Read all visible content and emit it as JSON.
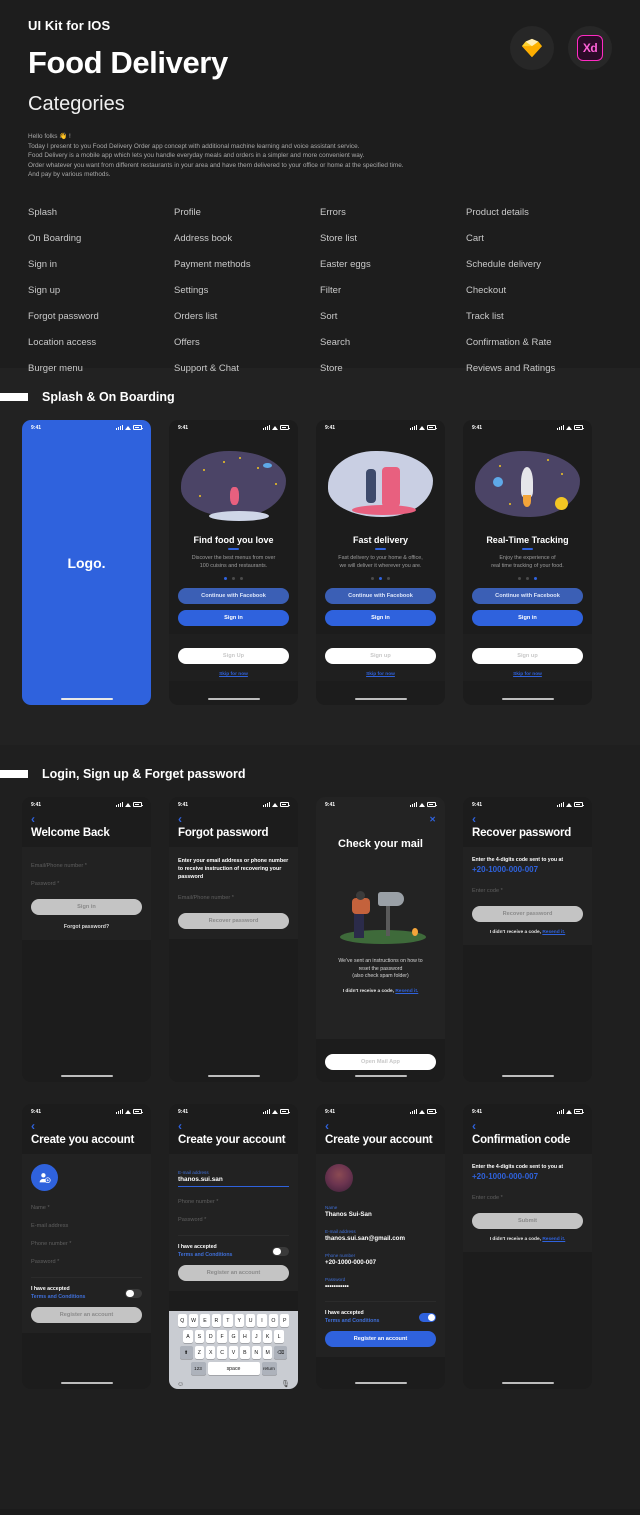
{
  "hero": {
    "kicker": "UI Kit for IOS",
    "title": "Food Delivery",
    "subtitle": "Categories",
    "desc_lines": [
      "Hello folks 👋 !",
      "Today I present to you Food Delivery Order app concept with additional machine learning and voice assistant service.",
      "Food Delivery is a mobile app which lets you handle everyday meals and orders in a simpler and more convenient way.",
      "Order whatever you want from different restaurants in your area and have them delivered to your office or home at the specified time.",
      "And pay by various methods."
    ],
    "badges": [
      {
        "name": "sketch-badge",
        "label": ""
      },
      {
        "name": "adobe-xd-badge",
        "label": "Xd"
      }
    ]
  },
  "categories": [
    "Splash",
    "Profile",
    "Errors",
    "Product details",
    "On Boarding",
    "Address book",
    "Store list",
    "Cart",
    "Sign in",
    "Payment methods",
    "Easter eggs",
    "Schedule delivery",
    "Sign up",
    "Settings",
    "Filter",
    "Checkout",
    "Forgot password",
    "Orders list",
    "Sort",
    "Track list",
    "Location access",
    "Offers",
    "Search",
    "Confirmation & Rate",
    "Burger menu",
    "Support & Chat",
    "Store",
    "Reviews and Ratings"
  ],
  "sections": {
    "onboarding_title": "Splash & On Boarding",
    "login_title": "Login, Sign up & Forget password"
  },
  "status": {
    "time": "9:41"
  },
  "splash": {
    "logo": "Logo."
  },
  "onboarding": [
    {
      "title": "Find food you love",
      "subtitle_line1": "Discover the best menus from over",
      "subtitle_line2": "100 cuisins and restaurants.",
      "active_dot": 0,
      "btn_facebook": "Continue with Facebook",
      "btn_signin": "Sign in",
      "btn_signup": "Sign Up",
      "skip": "Skip for now"
    },
    {
      "title": "Fast delivery",
      "subtitle_line1": "Fast delivery to your home & office,",
      "subtitle_line2": "we will deliver it wherever you are.",
      "active_dot": 1,
      "btn_facebook": "Continue with Facebook",
      "btn_signin": "Sign in",
      "btn_signup": "Sign up",
      "skip": "Skip for now"
    },
    {
      "title": "Real-Time Tracking",
      "subtitle_line1": "Enjoy the experience of",
      "subtitle_line2": "real time tracking of your food.",
      "active_dot": 2,
      "btn_facebook": "Continue with Facebook",
      "btn_signin": "Sign in",
      "btn_signup": "Sign up",
      "skip": "Skip for now"
    }
  ],
  "login": {
    "title": "Welcome Back",
    "field_email": "Email/Phone number *",
    "field_password": "Password *",
    "btn_signin": "Sign in",
    "forgot": "Forgot password?"
  },
  "forgot": {
    "title": "Forgot password",
    "instruction": "Enter your email address or phone number to receive instruction of recovering your password",
    "field_email": "Email/Phone number *",
    "btn_recover": "Recover password"
  },
  "check_mail": {
    "title": "Check your mail",
    "body_line1": "We've sent an instructions on how to",
    "body_line2": "reset the password",
    "body_line3": "(also check spam folder)",
    "resend_prefix": "I didn't receive a code,",
    "resend_link": "Resend it.",
    "btn_open": "Open Mail App"
  },
  "recover": {
    "title": "Recover password",
    "instruction": "Enter the 4-digits code sent to you at",
    "phone": "+20-1000-000-007",
    "field_code": "Enter code *",
    "btn_recover": "Recover password",
    "resend_prefix": "I didn't receive a code,",
    "resend_link": "Resend it."
  },
  "create_empty": {
    "title": "Create you account",
    "avatar_icon": "add-photo-icon",
    "field_name": "Name *",
    "field_email": "E-mail address",
    "field_phone": "Phone number *",
    "field_password": "Password *",
    "accept_line1": "I have accepted",
    "accept_line2": "Terms and Conditions",
    "toggle_on": false,
    "btn_register": "Register an account"
  },
  "create_typing": {
    "title": "Create your account",
    "label_email": "E-mail address",
    "value_email": "thanos.sui.san",
    "field_phone": "Phone number *",
    "field_password": "Password *",
    "accept_line1": "I have accepted",
    "accept_line2": "Terms and Conditions",
    "toggle_on": false,
    "btn_register": "Register an account",
    "keyboard": {
      "row1": [
        "Q",
        "W",
        "E",
        "R",
        "T",
        "Y",
        "U",
        "I",
        "O",
        "P"
      ],
      "row2": [
        "A",
        "S",
        "D",
        "F",
        "G",
        "H",
        "J",
        "K",
        "L"
      ],
      "row3": [
        "Z",
        "X",
        "C",
        "V",
        "B",
        "N",
        "M"
      ],
      "shift": "⬆",
      "backspace": "⌫",
      "numbers": "123",
      "space": "space",
      "return": "return",
      "emoji": "☺",
      "mic": "🎙"
    }
  },
  "create_filled": {
    "title": "Create your account",
    "label_name": "Name",
    "value_name": "Thanos Sui-San",
    "label_email": "E-mail address",
    "value_email": "thanos.sui.san@gmail.com",
    "label_phone": "Phone number",
    "value_phone": "+20-1000-000-007",
    "label_password": "Password",
    "value_password": "•••••••••••",
    "accept_line1": "I have accepted",
    "accept_line2": "Terms and Conditions",
    "toggle_on": true,
    "btn_register": "Register an account"
  },
  "confirmation": {
    "title": "Confirmation code",
    "instruction": "Enter the 4-digits code sent to you at",
    "phone": "+20-1000-000-007",
    "field_code": "Enter code *",
    "btn_submit": "Submit",
    "resend_prefix": "I didn't receive a code,",
    "resend_link": "Resend it."
  },
  "colors": {
    "accent": "#2f62dd",
    "bg": "#1b1b1b",
    "panel": "#222222",
    "grey_btn": "#c4c4c4"
  }
}
